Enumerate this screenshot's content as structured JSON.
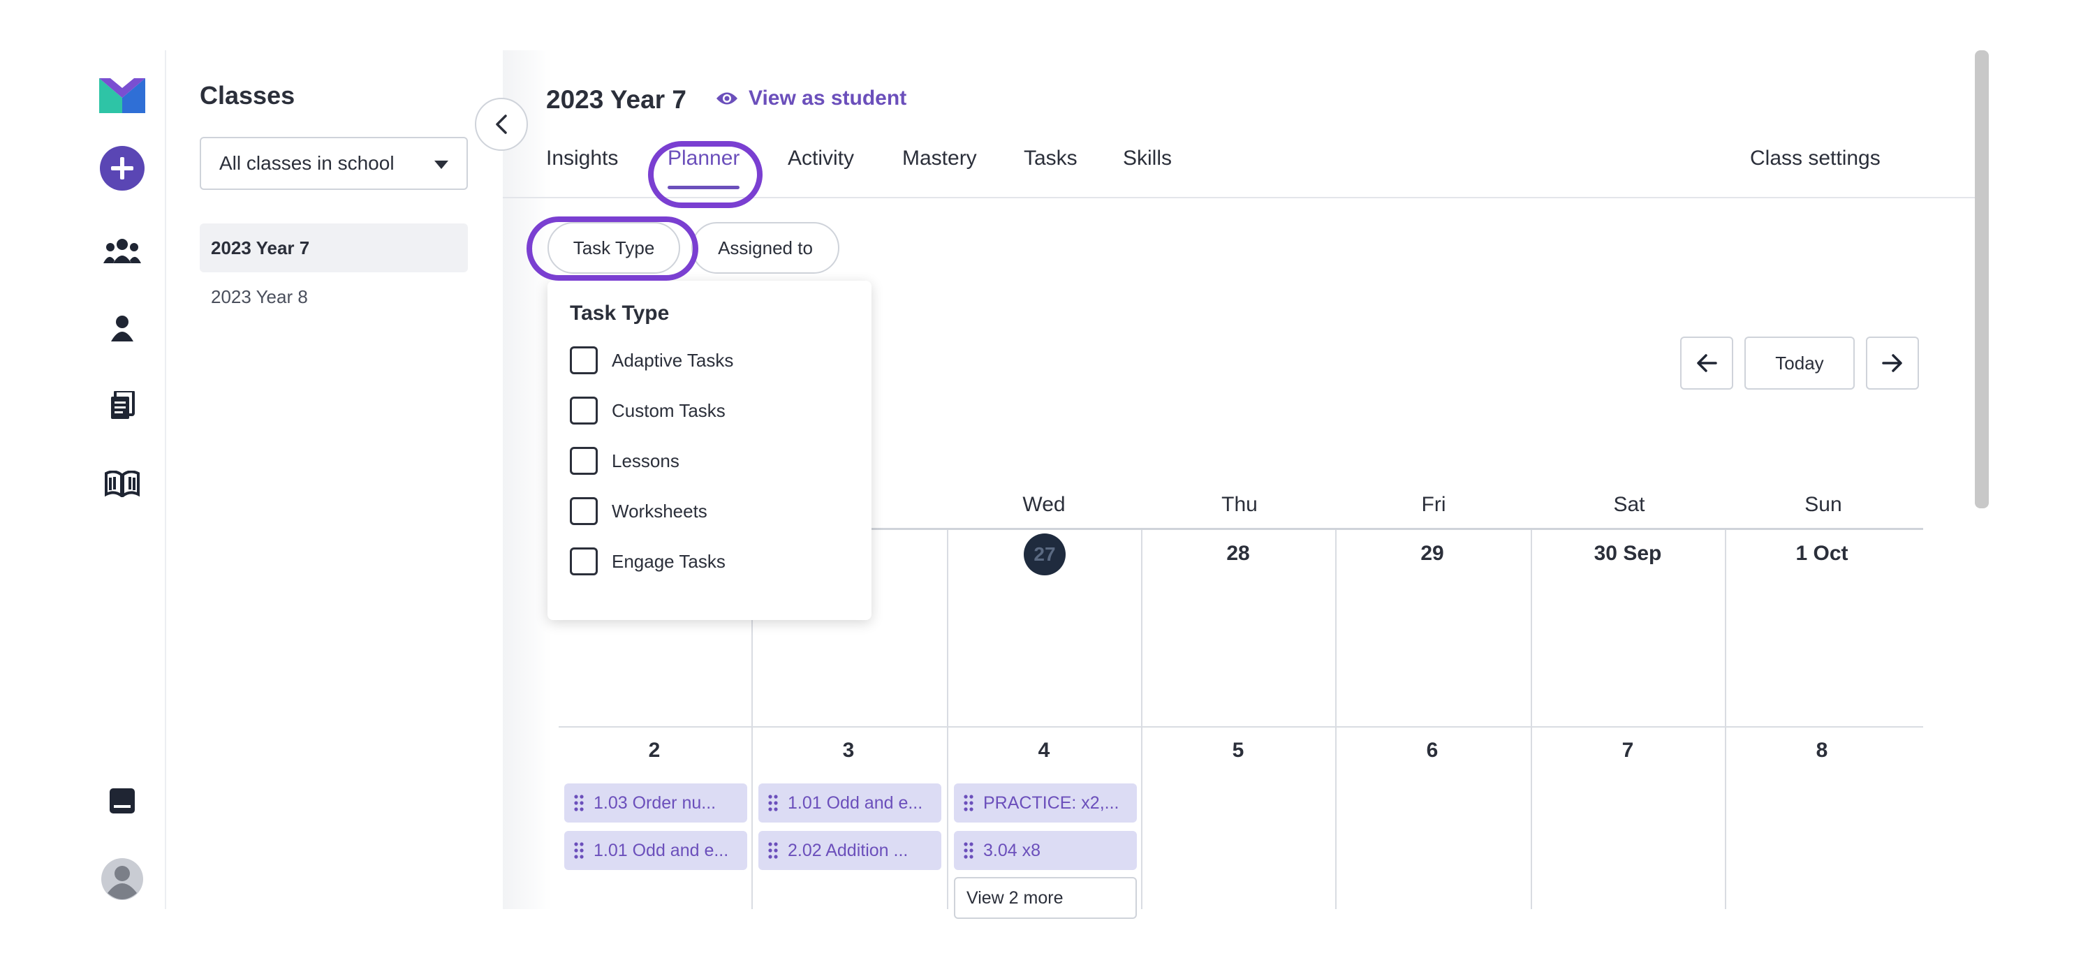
{
  "rail": {
    "logo": "logo-icon",
    "items": [
      {
        "name": "add-icon"
      },
      {
        "name": "classes-icon"
      },
      {
        "name": "student-icon"
      },
      {
        "name": "tasks-icon"
      },
      {
        "name": "library-icon"
      },
      {
        "name": "inbox-icon"
      },
      {
        "name": "avatar"
      }
    ],
    "accent": "#6b4fbb"
  },
  "sidebar": {
    "title": "Classes",
    "select_value": "All classes in school",
    "items": [
      {
        "label": "2023 Year 7",
        "active": true
      },
      {
        "label": "2023 Year 8",
        "active": false
      }
    ]
  },
  "header": {
    "class_title": "2023 Year 7",
    "view_as_student": "View as student",
    "tabs": [
      {
        "label": "Insights"
      },
      {
        "label": "Planner"
      },
      {
        "label": "Activity"
      },
      {
        "label": "Mastery"
      },
      {
        "label": "Tasks"
      },
      {
        "label": "Skills"
      }
    ],
    "class_settings": "Class settings",
    "active_tab": "Planner"
  },
  "filters": {
    "task_type": "Task Type",
    "assigned_to": "Assigned to"
  },
  "dropdown": {
    "title": "Task Type",
    "options": [
      {
        "label": "Adaptive Tasks",
        "checked": false
      },
      {
        "label": "Custom Tasks",
        "checked": false
      },
      {
        "label": "Lessons",
        "checked": false
      },
      {
        "label": "Worksheets",
        "checked": false
      },
      {
        "label": "Engage Tasks",
        "checked": false
      }
    ]
  },
  "nav": {
    "today": "Today"
  },
  "calendar": {
    "day_headers": [
      "Wed",
      "Thu",
      "Fri",
      "Sat",
      "Sun"
    ],
    "week1_dates": [
      "27",
      "28",
      "29",
      "30 Sep",
      "1 Oct"
    ],
    "week2_dates": [
      "2",
      "3",
      "4",
      "5",
      "6",
      "7",
      "8"
    ],
    "tasks": {
      "col0": [
        "1.03 Order nu...",
        "1.01 Odd and e..."
      ],
      "col1": [
        "1.01 Odd and e...",
        "2.02 Addition ..."
      ],
      "col2": [
        "PRACTICE: x2,...",
        "3.04 x8"
      ]
    },
    "view_more": "View 2 more"
  },
  "colors": {
    "accent": "#6b4fbb",
    "highlight": "#7a3fd1",
    "task_chip_bg": "#dcdcf4",
    "today_circle": "#1f2b3e"
  }
}
